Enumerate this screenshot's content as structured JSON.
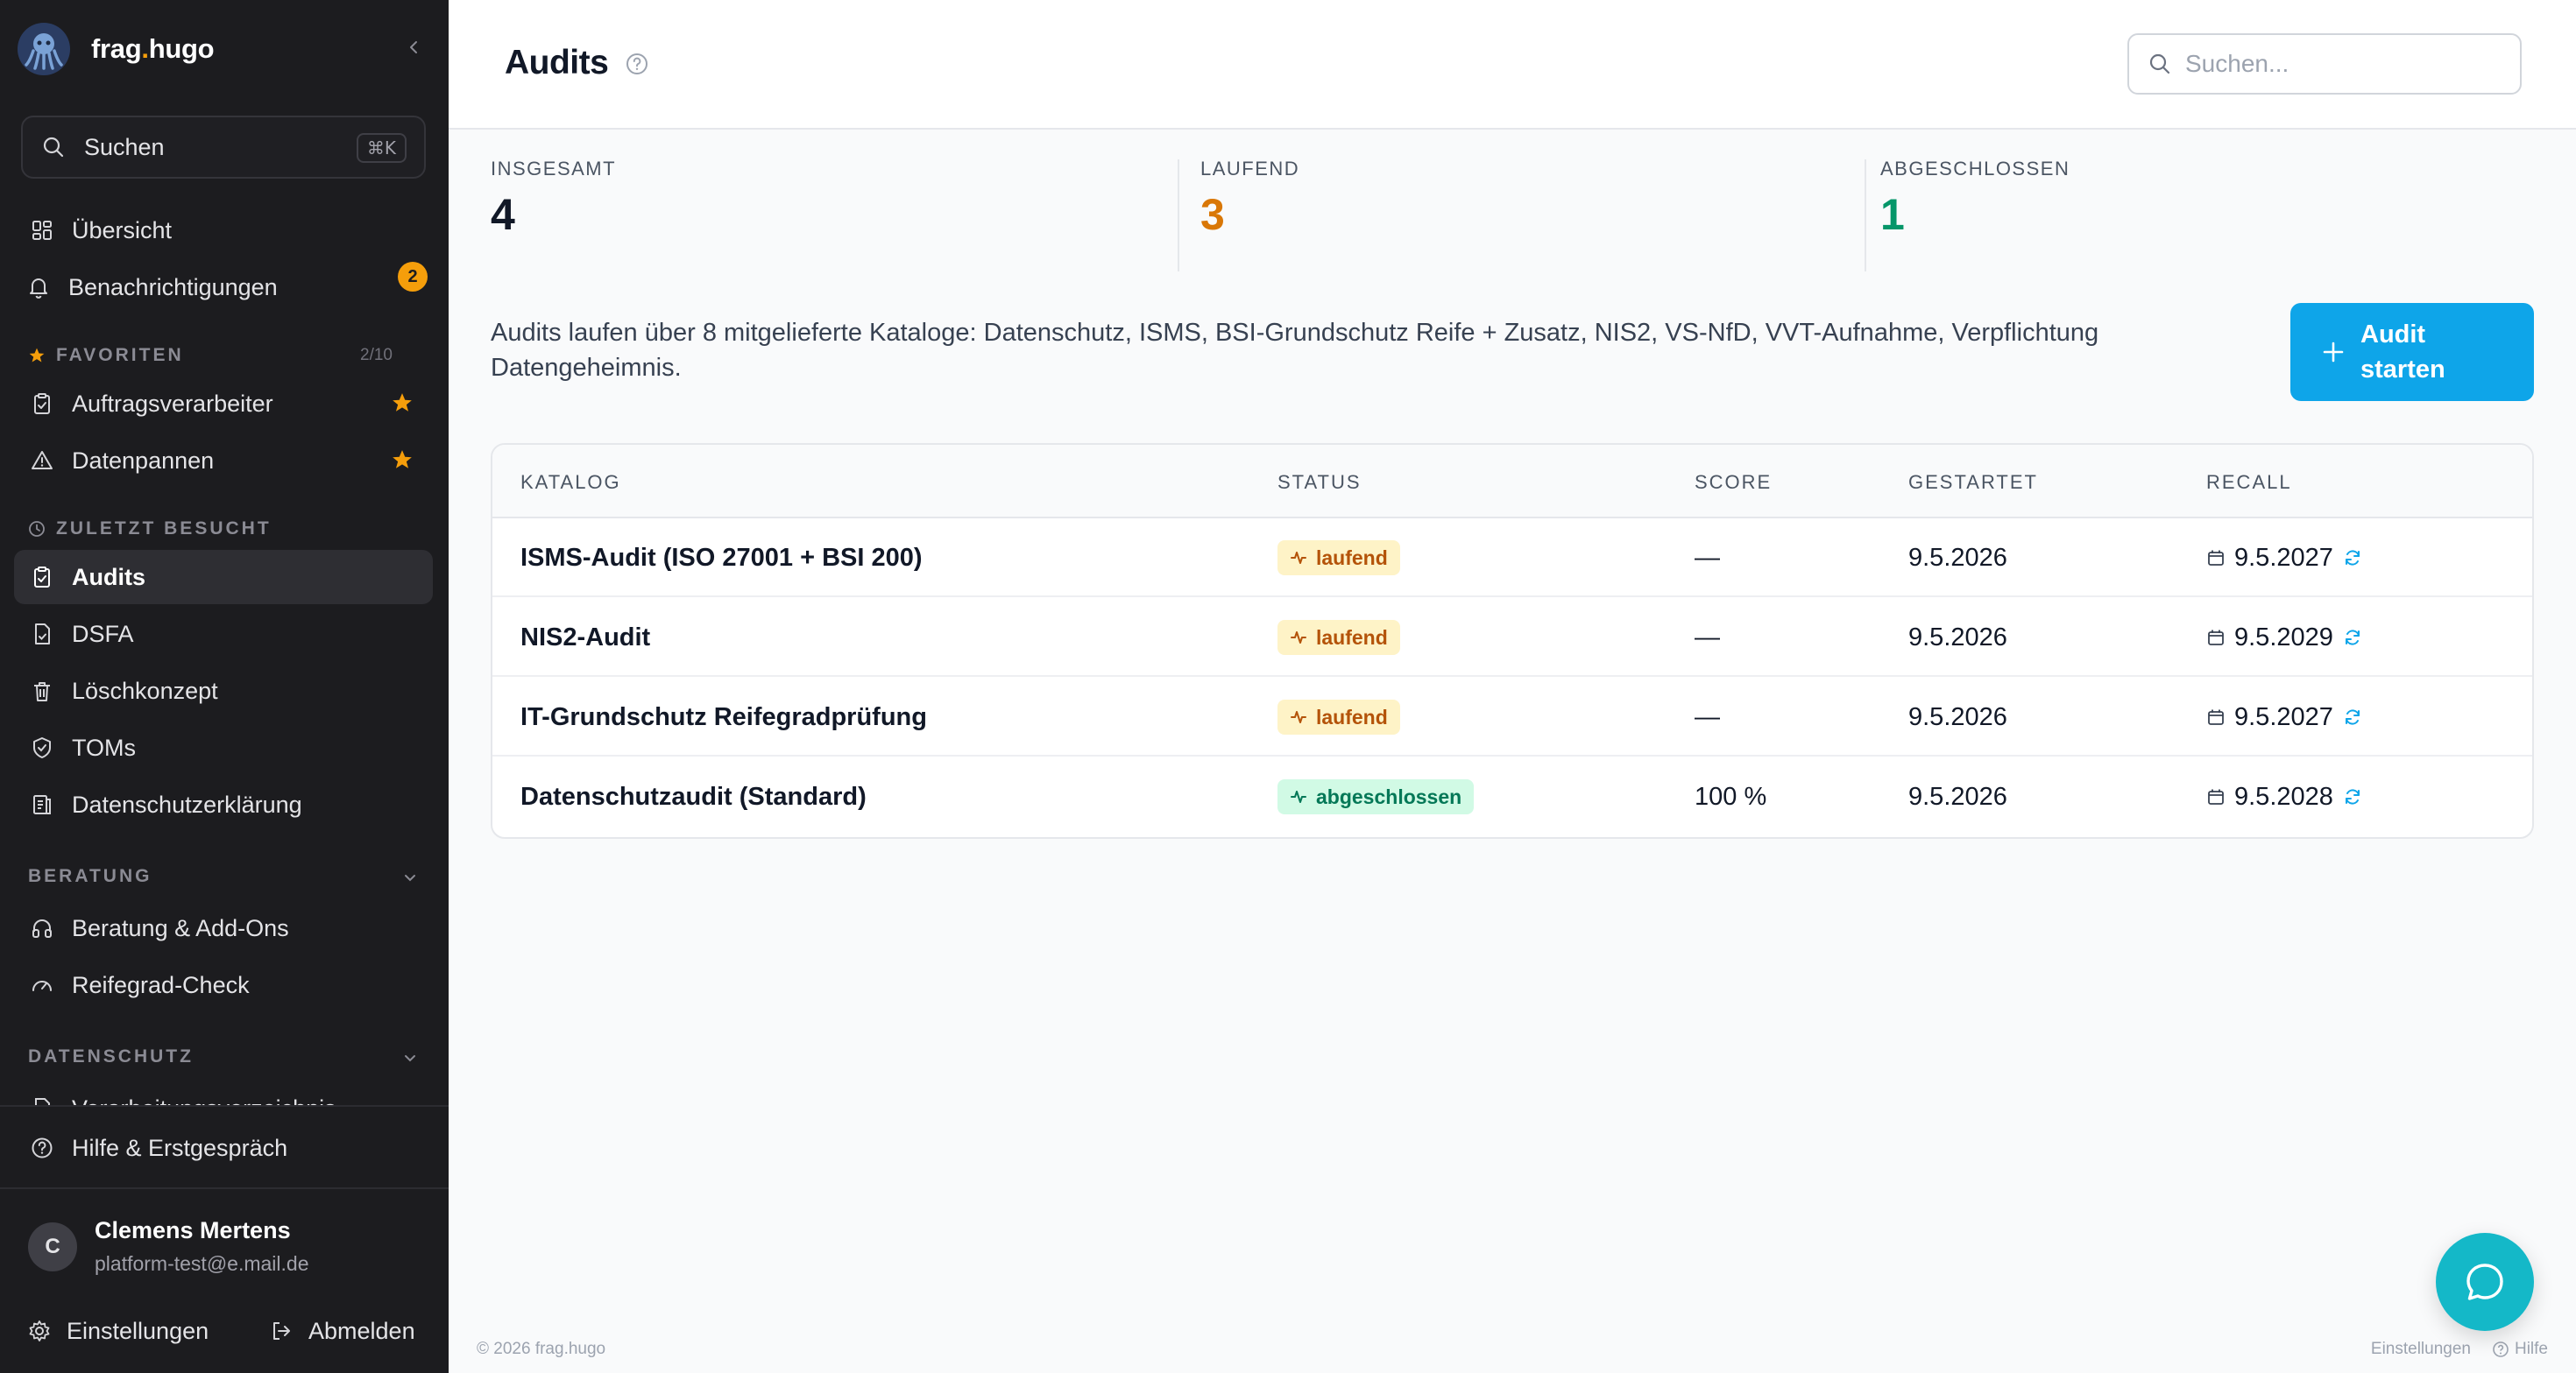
{
  "brand": {
    "name_prefix": "frag",
    "name_dot": ".",
    "name_suffix": "hugo"
  },
  "sidebar": {
    "search_label": "Suchen",
    "search_shortcut": "⌘K",
    "items": [
      {
        "label": "Übersicht",
        "icon": "grid-icon"
      },
      {
        "label": "Benachrichtigungen",
        "icon": "bell-icon",
        "badge": "2"
      }
    ],
    "favorites": {
      "title": "FAVORITEN",
      "count": "2/10",
      "items": [
        {
          "label": "Auftragsverarbeiter",
          "icon": "clipboard-check-icon"
        },
        {
          "label": "Datenpannen",
          "icon": "warning-icon"
        }
      ]
    },
    "recent": {
      "title": "ZULETZT BESUCHT",
      "items": [
        {
          "label": "Audits",
          "icon": "clipboard-check-icon",
          "active": true
        },
        {
          "label": "DSFA",
          "icon": "file-icon"
        },
        {
          "label": "Löschkonzept",
          "icon": "trash-icon"
        },
        {
          "label": "TOMs",
          "icon": "shield-check-icon"
        },
        {
          "label": "Datenschutzerklärung",
          "icon": "document-icon"
        }
      ]
    },
    "beratung": {
      "title": "BERATUNG",
      "items": [
        {
          "label": "Beratung & Add-Ons",
          "icon": "headphones-icon"
        },
        {
          "label": "Reifegrad-Check",
          "icon": "gauge-icon"
        }
      ]
    },
    "datenschutz": {
      "title": "DATENSCHUTZ",
      "items": [
        {
          "label": "Verarbeitungsverzeichnis",
          "icon": "file-icon"
        }
      ]
    },
    "help_label": "Hilfe & Erstgespräch",
    "user": {
      "initial": "C",
      "name": "Clemens Mertens",
      "email": "platform-test@e.mail.de"
    },
    "settings_label": "Einstellungen",
    "logout_label": "Abmelden"
  },
  "header": {
    "title": "Audits",
    "search_placeholder": "Suchen..."
  },
  "stats": [
    {
      "label": "INSGESAMT",
      "value": "4",
      "color": "#111827"
    },
    {
      "label": "LAUFEND",
      "value": "3",
      "color": "#d97706"
    },
    {
      "label": "ABGESCHLOSSEN",
      "value": "1",
      "color": "#059669"
    }
  ],
  "description": "Audits laufen über 8 mitgelieferte Kataloge: Datenschutz, ISMS, BSI-Grundschutz Reife + Zusatz, NIS2, VS-NfD, VVT-Aufnahme, Verpflichtung Datengeheimnis.",
  "start_button": "Audit starten",
  "table": {
    "columns": [
      "KATALOG",
      "STATUS",
      "SCORE",
      "GESTARTET",
      "RECALL"
    ],
    "rows": [
      {
        "katalog": "ISMS-Audit (ISO 27001 + BSI 200)",
        "status": "laufend",
        "status_type": "running",
        "score": "—",
        "gestartet": "9.5.2026",
        "recall": "9.5.2027"
      },
      {
        "katalog": "NIS2-Audit",
        "status": "laufend",
        "status_type": "running",
        "score": "—",
        "gestartet": "9.5.2026",
        "recall": "9.5.2029"
      },
      {
        "katalog": "IT-Grundschutz Reifegradprüfung",
        "status": "laufend",
        "status_type": "running",
        "score": "—",
        "gestartet": "9.5.2026",
        "recall": "9.5.2027"
      },
      {
        "katalog": "Datenschutzaudit (Standard)",
        "status": "abgeschlossen",
        "status_type": "done",
        "score": "100 %",
        "gestartet": "9.5.2026",
        "recall": "9.5.2028"
      }
    ]
  },
  "footer": {
    "copyright": "© 2026 frag.hugo",
    "settings_link": "Einstellungen",
    "help_link": "Hilfe"
  },
  "colors": {
    "accent": "#0ea5e9",
    "chat": "#14b8c8",
    "sidebar_bg": "#1c1c1f",
    "running": "#d97706",
    "done": "#059669"
  }
}
